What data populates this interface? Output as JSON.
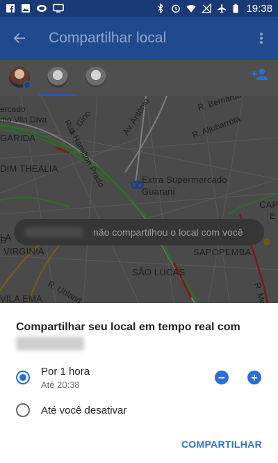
{
  "status_bar": {
    "time": "19:38",
    "left_icons": [
      "facebook-icon",
      "image-icon",
      "link-icon",
      "tv-icon"
    ],
    "right_icons": [
      "bluetooth-icon",
      "alarm-icon",
      "wifi-icon",
      "no-signal-icon",
      "airplane-icon",
      "battery-icon"
    ]
  },
  "app_bar": {
    "title": "Compartilhar local",
    "back_icon": "arrow-back-icon",
    "more_icon": "more-vert-icon"
  },
  "contacts": {
    "add_icon": "person-add-icon",
    "selected_index": 1
  },
  "map": {
    "labels": [
      "ercado",
      "mo Vila Diva",
      "GARIDA",
      "Rua Hamilton Prado",
      "R. Gino",
      "Av. Antônio",
      "R. Bernardo de Lima",
      "R. Aljubarrota",
      "DIM THEALIA",
      "Extra Supermercado",
      "Guarani",
      "CAP",
      "E",
      "D",
      "LA",
      "VIRGINIA",
      "SÃO LUCAS",
      "SAPOPEMBA",
      "R. Uhland",
      "VILA EMA",
      "R. Meire"
    ],
    "toast": "não compartilhou o local com você",
    "colors": {
      "background": "#4a4a4a",
      "traffic_green": "#2f6b2a",
      "traffic_red": "#7a1a1a",
      "traffic_orange": "#7a5a18",
      "road": "#7e7e7e"
    }
  },
  "sheet": {
    "title": "Compartilhar seu local em tempo real com",
    "option_1": {
      "label": "Por 1 hora",
      "sub": "Até 20:38",
      "checked": true
    },
    "option_2": {
      "label": "Até você desativar",
      "checked": false
    },
    "minus": "−",
    "plus": "+",
    "share_label": "COMPARTILHAR",
    "accent": "#2a6fd6"
  }
}
